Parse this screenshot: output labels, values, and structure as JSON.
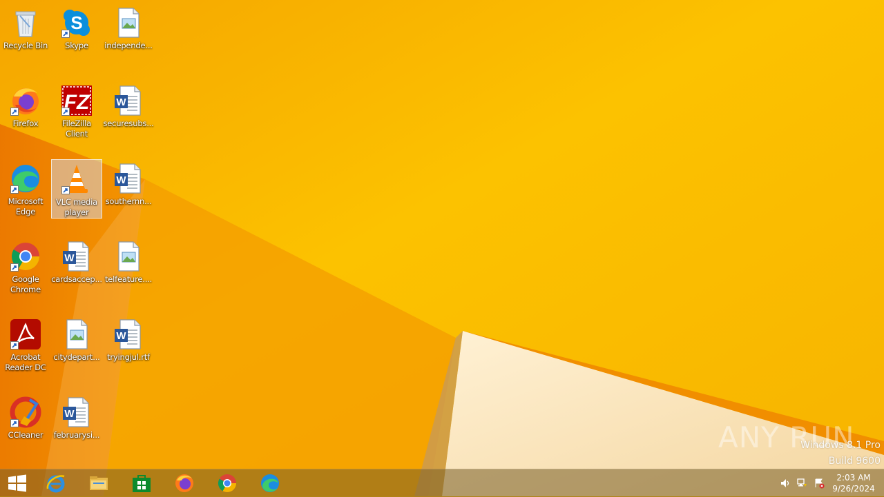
{
  "desktop": {
    "icons": [
      {
        "label": "Recycle Bin",
        "icon": "recycle-bin-icon"
      },
      {
        "label": "Skype",
        "icon": "skype-icon"
      },
      {
        "label": "independe...",
        "icon": "image-file-icon"
      },
      {
        "label": "Firefox",
        "icon": "firefox-icon"
      },
      {
        "label": "FileZilla Client",
        "icon": "filezilla-icon"
      },
      {
        "label": "securesubs...",
        "icon": "word-document-icon"
      },
      {
        "label": "Microsoft Edge",
        "icon": "edge-icon"
      },
      {
        "label": "VLC media player",
        "icon": "vlc-icon",
        "selected": true
      },
      {
        "label": "southernn...",
        "icon": "word-document-icon"
      },
      {
        "label": "Google Chrome",
        "icon": "chrome-icon"
      },
      {
        "label": "cardsaccep...",
        "icon": "word-document-icon"
      },
      {
        "label": "telfeature....",
        "icon": "image-file-icon"
      },
      {
        "label": "Acrobat Reader DC",
        "icon": "acrobat-icon"
      },
      {
        "label": "citydepart...",
        "icon": "image-file-icon"
      },
      {
        "label": "tryingjul.rtf",
        "icon": "word-document-icon"
      },
      {
        "label": "CCleaner",
        "icon": "ccleaner-icon"
      },
      {
        "label": "februarysi...",
        "icon": "word-document-icon"
      }
    ]
  },
  "watermark": {
    "logo_text": "ANY RUN",
    "os_name": "Windows 8.1 Pro",
    "os_build": "Build 9600"
  },
  "taskbar": {
    "pinned": [
      {
        "name": "internet-explorer-icon"
      },
      {
        "name": "file-explorer-icon"
      },
      {
        "name": "store-icon"
      },
      {
        "name": "firefox-icon"
      },
      {
        "name": "chrome-icon"
      },
      {
        "name": "edge-icon"
      }
    ],
    "clock": {
      "time": "2:03 AM",
      "date": "9/26/2024"
    }
  },
  "colors": {
    "wallpaper": "#f7b000",
    "accent": "#f28a00"
  }
}
